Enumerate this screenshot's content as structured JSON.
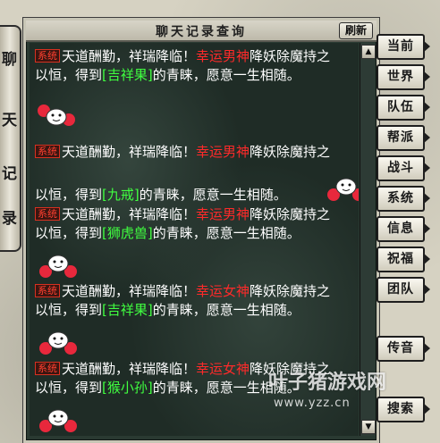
{
  "window": {
    "title": "聊天记录查询",
    "refresh_label": "刷新"
  },
  "left_scroll_chars": [
    "聊",
    "天",
    "记",
    "录"
  ],
  "messages": [
    {
      "tag": "系统",
      "prefix": "天道酬勤，祥瑞降临！",
      "name": "幸运男神",
      "middle": "降妖除魔持之",
      "line2_start": "以恒，得到",
      "item": "[吉祥果]",
      "line2_end": "的青睐，愿意一生相随。"
    },
    {
      "tag": "系统",
      "prefix": "天道酬勤，祥瑞降临！",
      "name": "幸运男神",
      "middle": "降妖除魔持之",
      "line2_start": "以恒，得到",
      "item": "[九戒]",
      "line2_end": "的青睐，愿意一生相随。"
    },
    {
      "tag": "系统",
      "prefix": "天道酬勤，祥瑞降临！",
      "name": "幸运男神",
      "middle": "降妖除魔持之",
      "line2_start": "以恒，得到",
      "item": "[狮虎兽]",
      "line2_end": "的青睐，愿意一生相随。"
    },
    {
      "tag": "系统",
      "prefix": "天道酬勤，祥瑞降临！",
      "name": "幸运女神",
      "middle": "降妖除魔持之",
      "line2_start": "以恒，得到",
      "item": "[吉祥果]",
      "line2_end": "的青睐，愿意一生相随。"
    },
    {
      "tag": "系统",
      "prefix": "天道酬勤，祥瑞降临！",
      "name": "幸运女神",
      "middle": "降妖除魔持之",
      "line2_start": "以恒，得到",
      "item": "[猴小孙]",
      "line2_end": "的青睐，愿意一生相随。"
    }
  ],
  "channels": {
    "current": "当前",
    "world": "世界",
    "team": "队伍",
    "guild": "帮派",
    "battle": "战斗",
    "system": "系统",
    "info": "信息",
    "blessing": "祝福",
    "group": "团队",
    "whisper": "传音",
    "search": "搜索"
  },
  "watermark": {
    "brand": "叶子猪游戏网",
    "url": "www.yzz.cn"
  },
  "colors": {
    "system_tag": "#ff4030",
    "name_red": "#ff2a2a",
    "item_green": "#40ff40",
    "chat_text": "#ffffff"
  }
}
